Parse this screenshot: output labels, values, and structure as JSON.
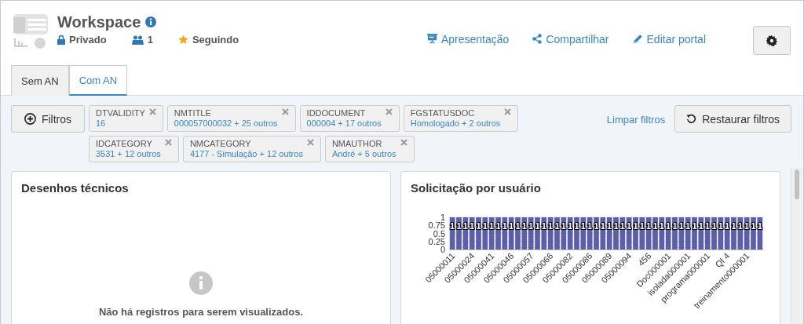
{
  "header": {
    "title": "Workspace",
    "privacy": "Privado",
    "members": "1",
    "follow": "Seguindo",
    "actions": [
      {
        "kind": "presentation",
        "label": "Apresentação"
      },
      {
        "kind": "share",
        "label": "Compartilhar"
      },
      {
        "kind": "edit",
        "label": "Editar portal"
      }
    ]
  },
  "tabs": [
    {
      "label": "Sem AN",
      "selected": false
    },
    {
      "label": "Com AN",
      "selected": true
    }
  ],
  "filters": {
    "button": "Filtros",
    "clear": "Limpar filtros",
    "restore": "Restaurar filtros",
    "chips": [
      {
        "name": "DTVALIDITY",
        "value": "16"
      },
      {
        "name": "NMTITLE",
        "value": "000057000032 + 25 outros"
      },
      {
        "name": "IDDOCUMENT",
        "value": "000004 + 17 outros"
      },
      {
        "name": "FGSTATUSDOC",
        "value": "Homologado + 2 outros"
      },
      {
        "name": "IDCATEGORY",
        "value": "3531 + 12 outros"
      },
      {
        "name": "NMCATEGORY",
        "value": "4177 - Simulação + 12 outros"
      },
      {
        "name": "NMAUTHOR",
        "value": "André + 5 outros"
      }
    ]
  },
  "panels": [
    {
      "kind": "empty",
      "title": "Desenhos técnicos",
      "message": "Não há registros para serem visualizados."
    },
    {
      "kind": "chart",
      "title": "Solicitação por usuário",
      "chart_data": {
        "type": "bar",
        "data_labels": true,
        "categories": [
          "05000011",
          null,
          null,
          "05000024",
          null,
          null,
          "05000041",
          null,
          null,
          "05000046",
          null,
          null,
          "05000057",
          null,
          null,
          "05000066",
          null,
          null,
          "05000082",
          null,
          null,
          "05000086",
          null,
          null,
          "05000089",
          null,
          null,
          "05000094",
          null,
          null,
          "456",
          null,
          null,
          "Doc000001",
          null,
          null,
          "isolada000001",
          null,
          null,
          "programa000001",
          null,
          null,
          "QI 4",
          null,
          null,
          "treinamento000001",
          null,
          null
        ],
        "ylim": [
          0,
          1
        ],
        "grid": true,
        "yticks": [
          0,
          0.25,
          0.5,
          0.75,
          1
        ],
        "series": [
          {
            "color": "#5b5fab",
            "values": [
              1,
              1,
              1,
              1,
              1,
              1,
              1,
              1,
              1,
              1,
              1,
              1,
              1,
              1,
              1,
              1,
              1,
              1,
              1,
              1,
              1,
              1,
              1,
              1,
              1,
              1,
              1,
              1,
              1,
              1,
              1,
              1,
              1,
              1,
              1,
              1,
              1,
              1,
              1,
              1,
              1,
              1,
              1,
              1,
              1,
              1,
              1,
              1
            ]
          }
        ]
      }
    }
  ]
}
